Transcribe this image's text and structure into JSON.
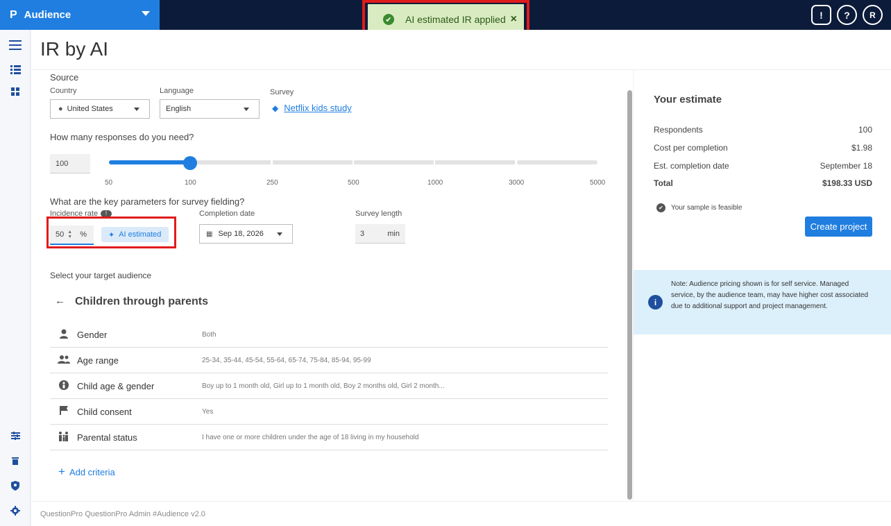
{
  "brand": {
    "logo": "P",
    "name": "Audience"
  },
  "toast": {
    "message": "AI estimated IR applied",
    "close": "×"
  },
  "top_icons": {
    "feedback": "!",
    "help": "?",
    "user": "R"
  },
  "page": {
    "title": "IR by AI"
  },
  "source": {
    "heading": "Source",
    "country_label": "Country",
    "country_value": "United States",
    "language_label": "Language",
    "language_value": "English",
    "survey_label": "Survey",
    "survey_value": "Netflix kids study"
  },
  "responses": {
    "question": "How many responses do you need?",
    "value": "100",
    "ticks": [
      "50",
      "100",
      "250",
      "500",
      "1000",
      "3000",
      "5000"
    ],
    "selected_tick": "100"
  },
  "params": {
    "question": "What are the key parameters for survey fielding?",
    "incidence_label": "Incidence rate",
    "incidence_value": "50",
    "incidence_unit": "%",
    "ai_badge": "AI estimated",
    "completion_label": "Completion date",
    "completion_value": "Sep 18, 2026",
    "length_label": "Survey length",
    "length_value": "3",
    "length_unit": "min"
  },
  "audience": {
    "heading": "Select your target audience",
    "title": "Children through parents",
    "criteria": [
      {
        "name": "Gender",
        "value": "Both",
        "icon": "person-icon"
      },
      {
        "name": "Age range",
        "value": "25-34, 35-44, 45-54, 55-64, 65-74, 75-84, 85-94, 95-99",
        "icon": "people-icon"
      },
      {
        "name": "Child age & gender",
        "value": "Boy up to 1 month old, Girl up to 1 month old, Boy 2 months old, Girl 2 month...",
        "icon": "child-icon"
      },
      {
        "name": "Child consent",
        "value": "Yes",
        "icon": "flag-icon"
      },
      {
        "name": "Parental status",
        "value": "I have one or more children under the age of 18 living in my household",
        "icon": "family-icon"
      }
    ],
    "add_criteria": "Add criteria"
  },
  "estimate": {
    "title": "Your estimate",
    "rows": [
      {
        "label": "Respondents",
        "value": "100"
      },
      {
        "label": "Cost per completion",
        "value": "$1.98"
      },
      {
        "label": "Est. completion date",
        "value": "September 18"
      },
      {
        "label": "Total",
        "value": "$198.33 USD"
      }
    ],
    "feasible": "Your sample is feasible",
    "create_button": "Create project",
    "note": "Note: Audience pricing shown is for self service. Managed service, by the audience team, may have higher cost associated due to additional support and project management."
  },
  "footer": {
    "text": "QuestionPro QuestionPro Admin  #Audience v2.0"
  },
  "colors": {
    "brand": "#1f7ee0",
    "topbar": "#0c1b3a",
    "highlight": "#e01b1b",
    "toast_bg": "#d9ecc1",
    "note_bg": "#dcf0fb"
  }
}
